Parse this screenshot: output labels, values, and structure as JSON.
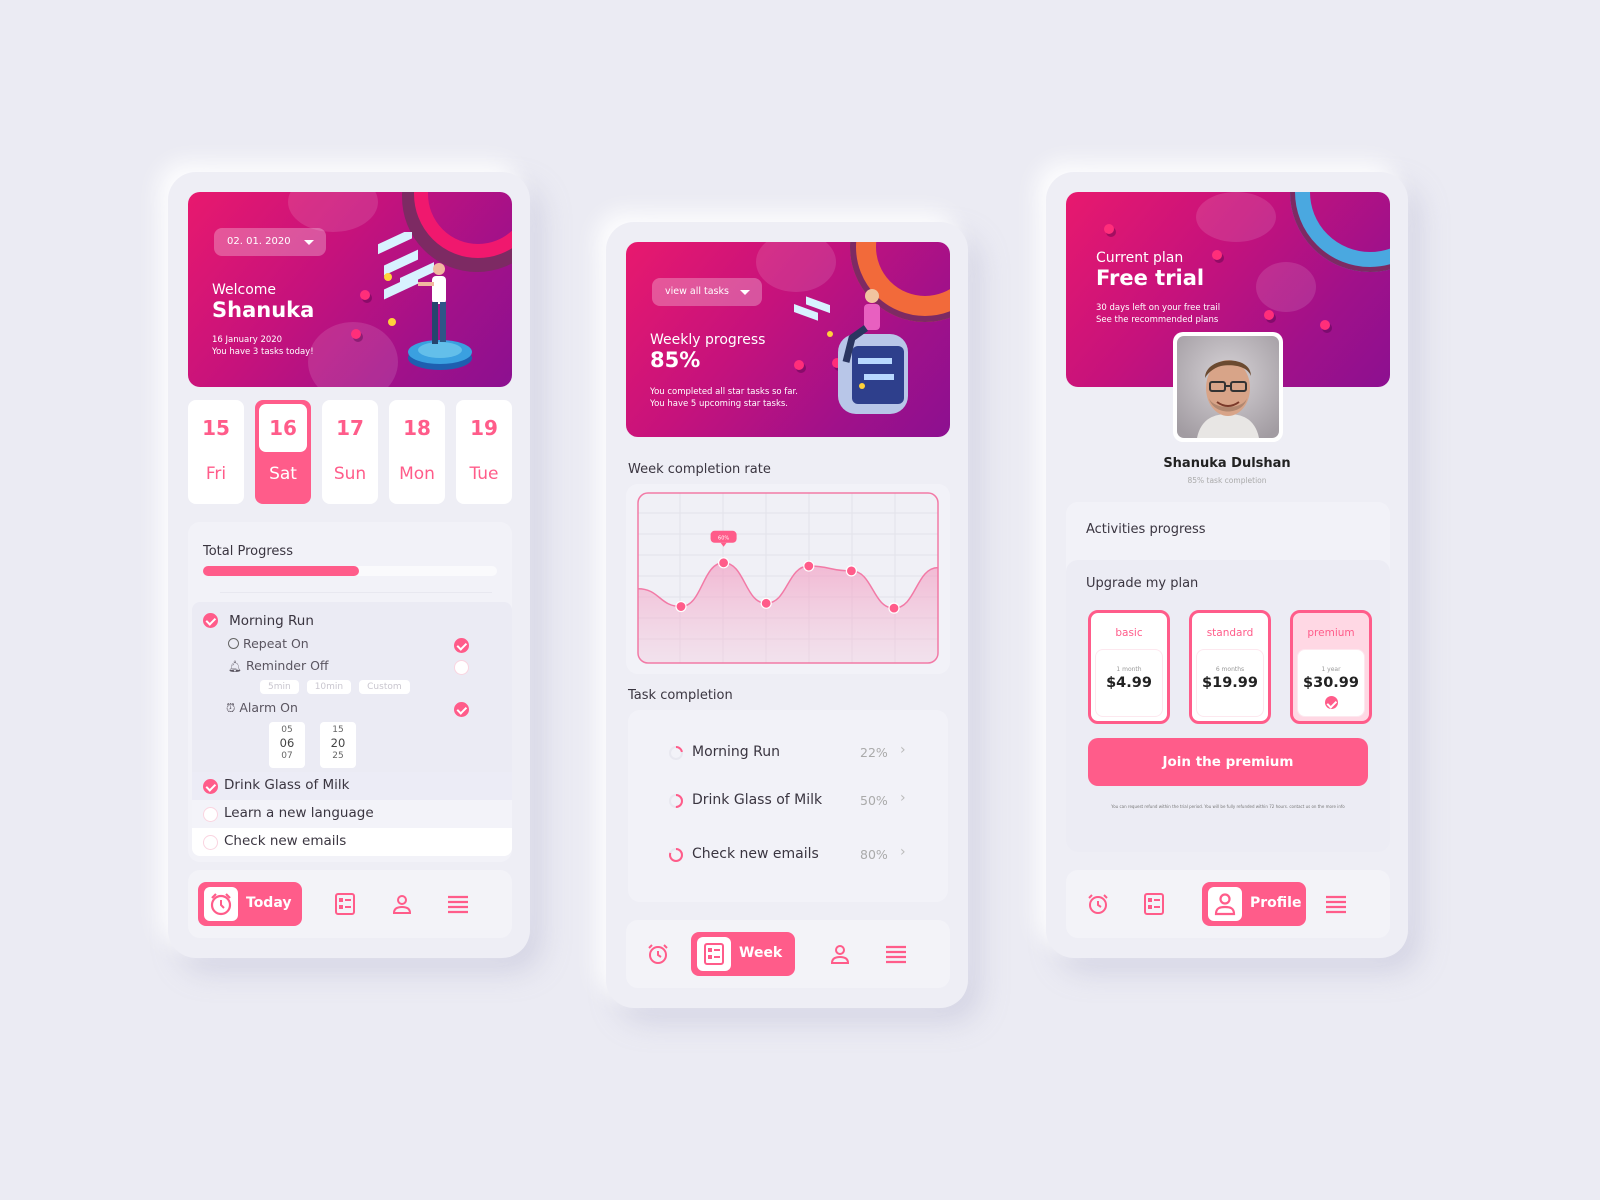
{
  "colors": {
    "accent": "#ff5c8a",
    "background": "#ebebf3",
    "hero_start": "#e8196e",
    "hero_end": "#8c1090"
  },
  "today": {
    "hero": {
      "date_dropdown": "02. 01. 2020",
      "greeting": "Welcome",
      "name": "Shanuka",
      "date_text": "16 January 2020",
      "tasks_text": "You have 3 tasks today!"
    },
    "days": [
      {
        "num": "15",
        "weekday": "Fri",
        "active": false
      },
      {
        "num": "16",
        "weekday": "Sat",
        "active": true
      },
      {
        "num": "17",
        "weekday": "Sun",
        "active": false
      },
      {
        "num": "18",
        "weekday": "Mon",
        "active": false
      },
      {
        "num": "19",
        "weekday": "Tue",
        "active": false
      }
    ],
    "progress": {
      "label": "Total Progress",
      "percent": 53
    },
    "expanded_task": {
      "title": "Morning Run",
      "done": true,
      "options": [
        {
          "icon": "repeat-icon",
          "label": "Repeat On",
          "on": true
        },
        {
          "icon": "bell-icon",
          "label": "Reminder Off",
          "on": false
        },
        {
          "icon": "alarm-icon",
          "label": "Alarm On",
          "on": true
        }
      ],
      "reminder_chips": [
        "5min",
        "10min",
        "Custom"
      ],
      "alarm_picker": {
        "hours": [
          "05",
          "06",
          "07"
        ],
        "minutes": [
          "15",
          "20",
          "25"
        ]
      }
    },
    "tasks": [
      {
        "title": "Drink Glass of Milk",
        "done": true
      },
      {
        "title": "Learn a new language",
        "done": false
      },
      {
        "title": "Check new emails",
        "done": false
      }
    ],
    "nav": {
      "active_label": "Today"
    }
  },
  "week": {
    "hero": {
      "dropdown": "view all tasks",
      "title": "Weekly progress",
      "value": "85%",
      "line1": "You completed all star tasks so far.",
      "line2": "You have 5 upcoming star tasks."
    },
    "chart_title": "Week completion rate",
    "task_completion_title": "Task completion",
    "task_completion": [
      {
        "title": "Morning Run",
        "percent": 22,
        "label": "22%"
      },
      {
        "title": "Drink Glass of Milk",
        "percent": 50,
        "label": "50%"
      },
      {
        "title": "Check new emails",
        "percent": 80,
        "label": "80%"
      }
    ],
    "nav": {
      "active_label": "Week"
    }
  },
  "chart_data": {
    "type": "area",
    "title": "Week completion rate",
    "xlabel": "",
    "ylabel": "",
    "grid": true,
    "points": [
      {
        "x": 1,
        "y": 33
      },
      {
        "x": 2,
        "y": 60
      },
      {
        "x": 3,
        "y": 35
      },
      {
        "x": 4,
        "y": 58
      },
      {
        "x": 5,
        "y": 55
      },
      {
        "x": 6,
        "y": 32
      }
    ],
    "curve_start_y": 44,
    "curve_end_y": 57,
    "highlight": {
      "index": 1,
      "label": "60%"
    },
    "ylim": [
      0,
      100
    ]
  },
  "profile": {
    "hero": {
      "label": "Current plan",
      "plan": "Free trial",
      "line1": "30 days left on your free trail",
      "line2": "See the recommended plans"
    },
    "user_name": "Shanuka Dulshan",
    "user_sub": "85% task completion",
    "activities_title": "Activities progress",
    "upgrade_title": "Upgrade my plan",
    "plans": [
      {
        "name": "basic",
        "period": "1 month",
        "price": "$4.99",
        "selected": false
      },
      {
        "name": "standard",
        "period": "6 months",
        "price": "$19.99",
        "selected": false
      },
      {
        "name": "premium",
        "period": "1 year",
        "price": "$30.99",
        "selected": true
      }
    ],
    "cta": "Join the premium",
    "fine_print": "You can request refund within the trial period. You will be fully refunded within 72 hours. contact us on the more info",
    "nav": {
      "active_label": "Profile"
    }
  }
}
